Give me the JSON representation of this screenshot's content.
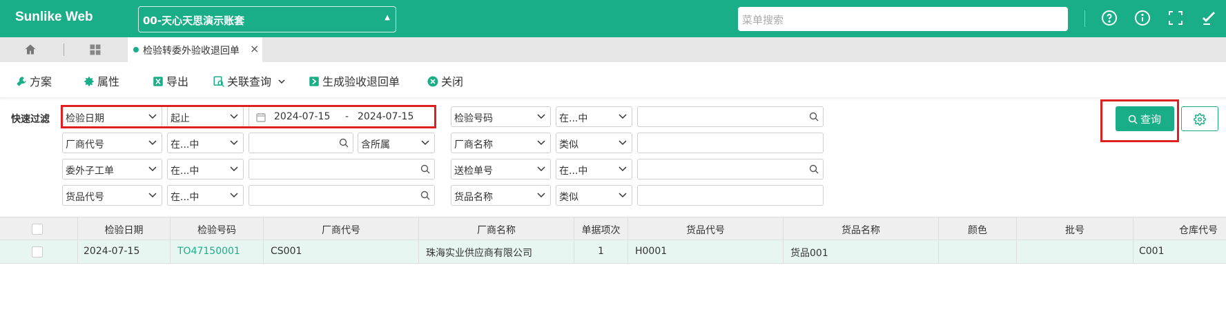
{
  "header": {
    "brand": "Sunlike Web",
    "account": "00-天心天思演示账套",
    "search_placeholder": "菜单搜索",
    "icons": [
      "help-icon",
      "info-icon",
      "fullscreen-icon",
      "user-settings-icon"
    ]
  },
  "tabs": {
    "active": "检验转委外验收退回单",
    "icons": [
      "home-icon",
      "apps-grid-icon",
      "close-icon"
    ]
  },
  "toolbar": {
    "scheme": "方案",
    "properties": "属性",
    "export": "导出",
    "related_query": "关联查询",
    "generate": "生成验收退回单",
    "close": "关闭"
  },
  "filter": {
    "label": "快速过滤",
    "row1": {
      "field": "检验日期",
      "op": "起止",
      "date_from": "2024-07-15",
      "date_sep": "-",
      "date_to": "2024-07-15",
      "field2": "检验号码",
      "op2": "在...中"
    },
    "row2": {
      "field": "厂商代号",
      "op": "在...中",
      "scope": "含所属",
      "field2": "厂商名称",
      "op2": "类似"
    },
    "row3": {
      "field": "委外子工单",
      "op": "在...中",
      "field2": "送检单号",
      "op2": "在...中"
    },
    "row4": {
      "field": "货品代号",
      "op": "在...中",
      "field2": "货品名称",
      "op2": "类似"
    },
    "query_button": "查询"
  },
  "table": {
    "columns": [
      "检验日期",
      "检验号码",
      "厂商代号",
      "厂商名称",
      "单据项次",
      "货品代号",
      "货品名称",
      "颜色",
      "批号",
      "仓库代号"
    ],
    "rows": [
      [
        "2024-07-15",
        "TO47150001",
        "CS001",
        "珠海实业供应商有限公司",
        "1",
        "H0001",
        "货品001",
        "",
        "",
        "C001"
      ]
    ]
  },
  "colors": {
    "primary": "#1aae88",
    "highlight": "#e02020",
    "row_selected": "#e8f6f1"
  }
}
